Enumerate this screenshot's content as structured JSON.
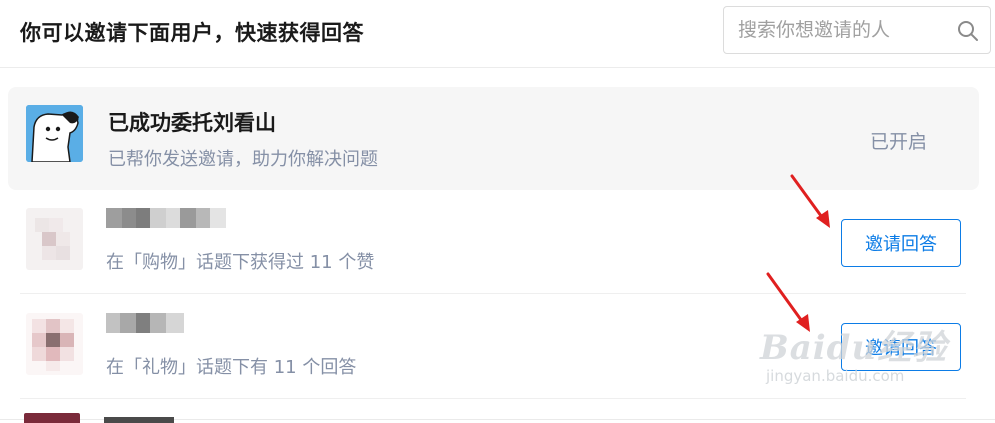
{
  "header": {
    "title": "你可以邀请下面用户，快速获得回答",
    "search_placeholder": "搜索你想邀请的人"
  },
  "featured": {
    "name": "已成功委托刘看山",
    "description": "已帮你发送邀请，助力你解决问题",
    "status": "已开启"
  },
  "users": [
    {
      "description": "在「购物」话题下获得过 11 个赞",
      "button": "邀请回答"
    },
    {
      "description": "在「礼物」话题下有 11 个回答",
      "button": "邀请回答"
    }
  ],
  "watermark": {
    "main": "Baidu经验",
    "sub": "jingyan.baidu.com"
  },
  "colors": {
    "accent": "#0c7ce6",
    "arrow": "#e02020",
    "muted_text": "#8590a6"
  }
}
